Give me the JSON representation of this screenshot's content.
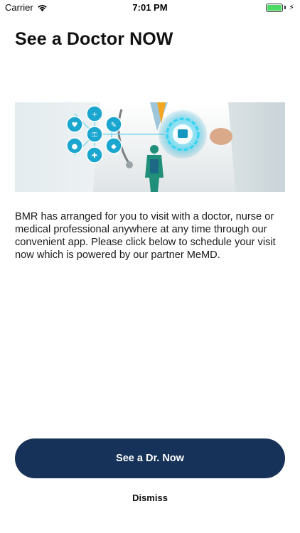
{
  "status_bar": {
    "carrier": "Carrier",
    "time": "7:01 PM",
    "battery_level": 1.0,
    "icons": [
      "wifi-icon",
      "battery-icon",
      "charging-bolt-icon"
    ]
  },
  "page": {
    "title": "See a Doctor NOW",
    "description": "BMR has arranged for you to visit with a doctor, nurse or medical professional anywhere at any time through our convenient app. Please click below to schedule your visit now which is powered by our partner MeMD."
  },
  "actions": {
    "primary_label": "See a Dr. Now",
    "dismiss_label": "Dismiss"
  },
  "colors": {
    "primary_button": "#173258",
    "battery_fill": "#4cd964",
    "hero_accent": "#1ec6e8"
  }
}
